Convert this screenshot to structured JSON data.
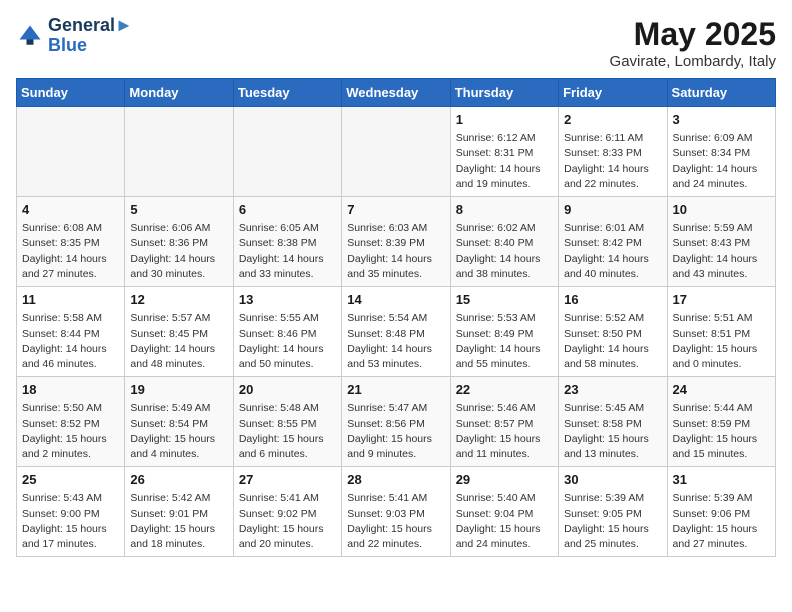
{
  "header": {
    "logo_line1": "General",
    "logo_line2": "Blue",
    "month": "May 2025",
    "location": "Gavirate, Lombardy, Italy"
  },
  "weekdays": [
    "Sunday",
    "Monday",
    "Tuesday",
    "Wednesday",
    "Thursday",
    "Friday",
    "Saturday"
  ],
  "weeks": [
    [
      {
        "num": "",
        "info": ""
      },
      {
        "num": "",
        "info": ""
      },
      {
        "num": "",
        "info": ""
      },
      {
        "num": "",
        "info": ""
      },
      {
        "num": "1",
        "info": "Sunrise: 6:12 AM\nSunset: 8:31 PM\nDaylight: 14 hours\nand 19 minutes."
      },
      {
        "num": "2",
        "info": "Sunrise: 6:11 AM\nSunset: 8:33 PM\nDaylight: 14 hours\nand 22 minutes."
      },
      {
        "num": "3",
        "info": "Sunrise: 6:09 AM\nSunset: 8:34 PM\nDaylight: 14 hours\nand 24 minutes."
      }
    ],
    [
      {
        "num": "4",
        "info": "Sunrise: 6:08 AM\nSunset: 8:35 PM\nDaylight: 14 hours\nand 27 minutes."
      },
      {
        "num": "5",
        "info": "Sunrise: 6:06 AM\nSunset: 8:36 PM\nDaylight: 14 hours\nand 30 minutes."
      },
      {
        "num": "6",
        "info": "Sunrise: 6:05 AM\nSunset: 8:38 PM\nDaylight: 14 hours\nand 33 minutes."
      },
      {
        "num": "7",
        "info": "Sunrise: 6:03 AM\nSunset: 8:39 PM\nDaylight: 14 hours\nand 35 minutes."
      },
      {
        "num": "8",
        "info": "Sunrise: 6:02 AM\nSunset: 8:40 PM\nDaylight: 14 hours\nand 38 minutes."
      },
      {
        "num": "9",
        "info": "Sunrise: 6:01 AM\nSunset: 8:42 PM\nDaylight: 14 hours\nand 40 minutes."
      },
      {
        "num": "10",
        "info": "Sunrise: 5:59 AM\nSunset: 8:43 PM\nDaylight: 14 hours\nand 43 minutes."
      }
    ],
    [
      {
        "num": "11",
        "info": "Sunrise: 5:58 AM\nSunset: 8:44 PM\nDaylight: 14 hours\nand 46 minutes."
      },
      {
        "num": "12",
        "info": "Sunrise: 5:57 AM\nSunset: 8:45 PM\nDaylight: 14 hours\nand 48 minutes."
      },
      {
        "num": "13",
        "info": "Sunrise: 5:55 AM\nSunset: 8:46 PM\nDaylight: 14 hours\nand 50 minutes."
      },
      {
        "num": "14",
        "info": "Sunrise: 5:54 AM\nSunset: 8:48 PM\nDaylight: 14 hours\nand 53 minutes."
      },
      {
        "num": "15",
        "info": "Sunrise: 5:53 AM\nSunset: 8:49 PM\nDaylight: 14 hours\nand 55 minutes."
      },
      {
        "num": "16",
        "info": "Sunrise: 5:52 AM\nSunset: 8:50 PM\nDaylight: 14 hours\nand 58 minutes."
      },
      {
        "num": "17",
        "info": "Sunrise: 5:51 AM\nSunset: 8:51 PM\nDaylight: 15 hours\nand 0 minutes."
      }
    ],
    [
      {
        "num": "18",
        "info": "Sunrise: 5:50 AM\nSunset: 8:52 PM\nDaylight: 15 hours\nand 2 minutes."
      },
      {
        "num": "19",
        "info": "Sunrise: 5:49 AM\nSunset: 8:54 PM\nDaylight: 15 hours\nand 4 minutes."
      },
      {
        "num": "20",
        "info": "Sunrise: 5:48 AM\nSunset: 8:55 PM\nDaylight: 15 hours\nand 6 minutes."
      },
      {
        "num": "21",
        "info": "Sunrise: 5:47 AM\nSunset: 8:56 PM\nDaylight: 15 hours\nand 9 minutes."
      },
      {
        "num": "22",
        "info": "Sunrise: 5:46 AM\nSunset: 8:57 PM\nDaylight: 15 hours\nand 11 minutes."
      },
      {
        "num": "23",
        "info": "Sunrise: 5:45 AM\nSunset: 8:58 PM\nDaylight: 15 hours\nand 13 minutes."
      },
      {
        "num": "24",
        "info": "Sunrise: 5:44 AM\nSunset: 8:59 PM\nDaylight: 15 hours\nand 15 minutes."
      }
    ],
    [
      {
        "num": "25",
        "info": "Sunrise: 5:43 AM\nSunset: 9:00 PM\nDaylight: 15 hours\nand 17 minutes."
      },
      {
        "num": "26",
        "info": "Sunrise: 5:42 AM\nSunset: 9:01 PM\nDaylight: 15 hours\nand 18 minutes."
      },
      {
        "num": "27",
        "info": "Sunrise: 5:41 AM\nSunset: 9:02 PM\nDaylight: 15 hours\nand 20 minutes."
      },
      {
        "num": "28",
        "info": "Sunrise: 5:41 AM\nSunset: 9:03 PM\nDaylight: 15 hours\nand 22 minutes."
      },
      {
        "num": "29",
        "info": "Sunrise: 5:40 AM\nSunset: 9:04 PM\nDaylight: 15 hours\nand 24 minutes."
      },
      {
        "num": "30",
        "info": "Sunrise: 5:39 AM\nSunset: 9:05 PM\nDaylight: 15 hours\nand 25 minutes."
      },
      {
        "num": "31",
        "info": "Sunrise: 5:39 AM\nSunset: 9:06 PM\nDaylight: 15 hours\nand 27 minutes."
      }
    ]
  ]
}
